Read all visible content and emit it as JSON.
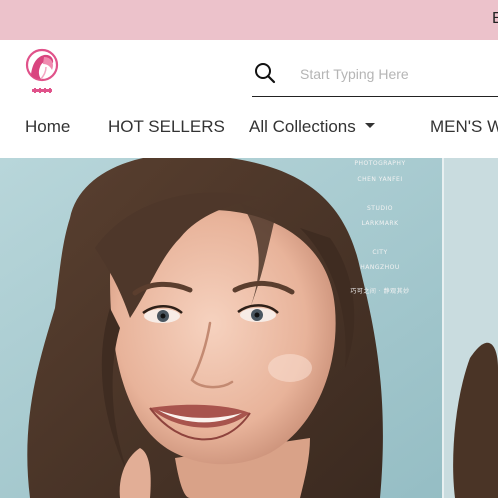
{
  "announcement": {
    "text": "E"
  },
  "brand": {
    "logo_icon": "rose-hair-logo-icon",
    "accent": "#e0528a"
  },
  "search": {
    "icon": "search-icon",
    "placeholder": "Start Typing Here"
  },
  "nav": {
    "items": [
      {
        "label": "Home"
      },
      {
        "label": "HOT SELLERS"
      },
      {
        "label": "All Collections",
        "has_dropdown": true,
        "dropdown_icon": "caret-down-icon"
      },
      {
        "label": "MEN'S W"
      }
    ]
  },
  "hero": {
    "overlay": {
      "line1": "PHOTOGRAPHY",
      "line2": "CHEN YANFEI",
      "line3": "STUDIO",
      "line4": "LARKMARK",
      "line5": "CITY",
      "line6": "HANGZHOU",
      "line7": "巧可之间 · 静观其妙"
    }
  },
  "colors": {
    "announcement_bg": "#ecc2cb",
    "header_bg": "#ffffff",
    "hero_bg": "#a7c9cf"
  }
}
